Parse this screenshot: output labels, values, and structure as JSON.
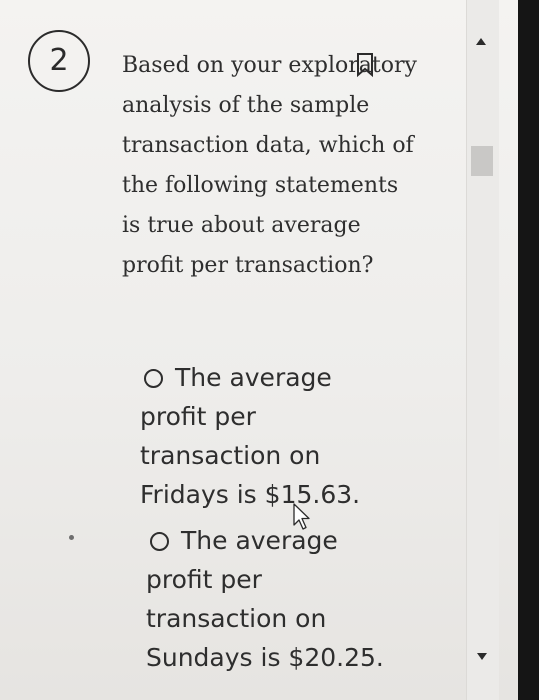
{
  "question": {
    "number": "2",
    "text": "Based on your exploratory analysis of the sample transaction data, which of the following statements is true about average profit per transaction?",
    "bookmark_icon": "bookmark-outline-icon"
  },
  "options": [
    {
      "text": "The average profit per transaction on Fridays is $15.63.",
      "selected": false
    },
    {
      "text": "The average profit per transaction on Sundays is $20.25.",
      "selected": false
    }
  ],
  "scrollbar": {
    "up_icon": "triangle-up-icon",
    "down_icon": "triangle-down-icon"
  },
  "colors": {
    "text": "#2e2e2e",
    "background": "#f2f1ef",
    "scroll_thumb": "#c9c8c6"
  }
}
